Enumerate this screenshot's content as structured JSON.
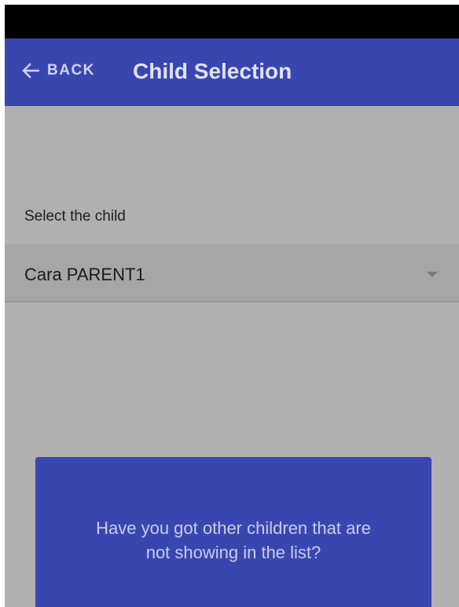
{
  "header": {
    "back_label": "BACK",
    "title": "Child Selection"
  },
  "form": {
    "select_label": "Select the child",
    "selected_child": "Cara PARENT1"
  },
  "info_card": {
    "text": "Have you got other children that are not showing in the list?"
  },
  "colors": {
    "primary": "#3a46b0",
    "overlay_background": "#b0b0b0",
    "status_bar": "#000000"
  },
  "icons": {
    "back": "arrow-left-icon",
    "dropdown": "caret-down-icon"
  }
}
